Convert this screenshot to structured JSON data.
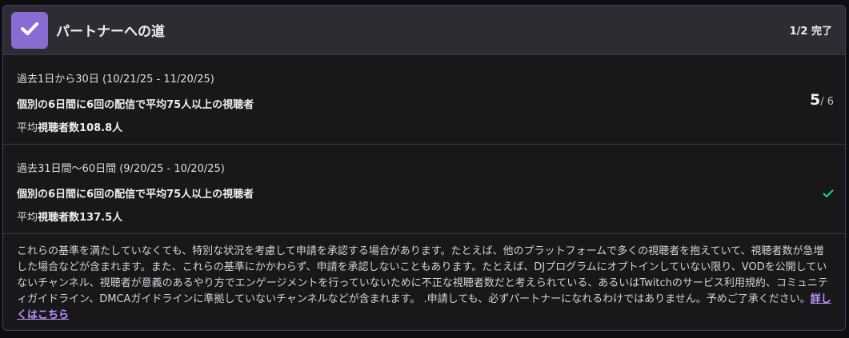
{
  "header": {
    "title": "パートナーへの道",
    "progress": "1/2 完了",
    "badge_icon": "checkmark-icon",
    "accent": "#8a6bd1"
  },
  "sections": [
    {
      "period": "過去1日から30日 (10/21/25 - 11/20/25)",
      "requirement": "個別の6日間に6回の配信で平均75人以上の視聴者",
      "avg_prefix": "平均",
      "avg_value": "視聴者数108.8人",
      "count_current": "5",
      "count_total": "/ 6"
    },
    {
      "period": "過去31日間〜60日間 (9/20/25 - 10/20/25)",
      "requirement": "個別の6日間に6回の配信で平均75人以上の視聴者",
      "avg_prefix": "平均",
      "avg_value": "視聴者数137.5人",
      "status_icon": "checkmark-icon",
      "status_color": "#00f593"
    }
  ],
  "note": {
    "text": "これらの基準を満たしていなくても、特別な状況を考慮して申請を承認する場合があります。たとえば、他のプラットフォームで多くの視聴者を抱えていて、視聴者数が急増した場合などが含まれます。また、これらの基準にかかわらず、申請を承認しないこともあります。たとえば、DJプログラムにオプトインしていない限り、VODを公開していないチャンネル、視聴者が意義のあるやり方でエンゲージメントを行っていないために不正な視聴者数だと考えられている、あるいはTwitchのサービス利用規約、コミュニティガイドライン、DMCAガイドラインに準拠していないチャンネルなどが含まれます。 .申請しても、必ずパートナーになれるわけではありません。予めご了承ください。",
    "link_label": "詳しくはこちら",
    "link_color": "#bf94ff"
  }
}
